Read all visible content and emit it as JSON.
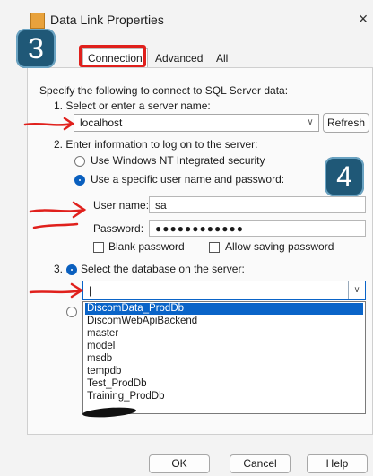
{
  "window": {
    "title": "Data Link Properties",
    "close_glyph": "×"
  },
  "tabs": [
    {
      "label": "Connection",
      "active": true
    },
    {
      "label": "Advanced",
      "active": false
    },
    {
      "label": "All",
      "active": false
    }
  ],
  "connection": {
    "intro": "Specify the following to connect to SQL Server data:",
    "step1_label": "1. Select or enter a server name:",
    "server_value": "localhost",
    "refresh_label": "Refresh",
    "step2_label": "2. Enter information to log on to the server:",
    "radio_windows_label": "Use Windows NT Integrated security",
    "radio_specific_label": "Use a specific user name and password:",
    "username_label": "User name:",
    "username_value": "sa",
    "password_label": "Password:",
    "password_value": "●●●●●●●●●●●●",
    "blank_password_label": "Blank password",
    "allow_saving_label": "Allow saving password",
    "step3_label": "3.",
    "select_db_label": "Select the database on the server:",
    "database_value": "|",
    "database_options": [
      "DiscomData_ProdDb",
      "DiscomWebApiBackend",
      "master",
      "model",
      "msdb",
      "tempdb",
      "Test_ProdDb",
      "Training_ProdDb"
    ],
    "selected_option_index": 0
  },
  "footer": {
    "ok_label": "OK",
    "cancel_label": "Cancel",
    "help_label": "Help"
  },
  "annotations": {
    "badge_3": "3",
    "badge_4": "4",
    "highlight_color": "#e0201c",
    "badge_color": "#1f5877"
  }
}
